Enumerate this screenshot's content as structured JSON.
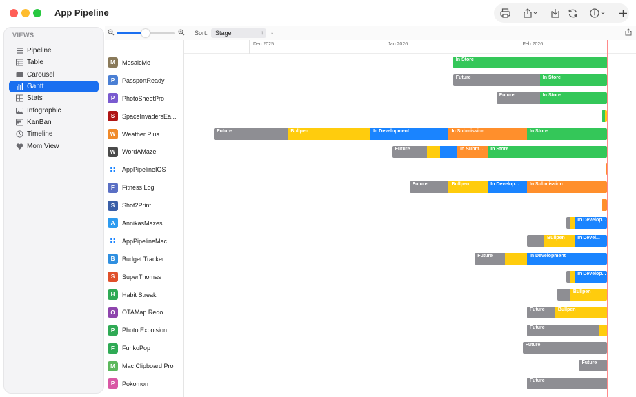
{
  "window": {
    "title": "App Pipeline"
  },
  "toolbar_icons": [
    "printer-icon",
    "share-icon",
    "download-icon",
    "sync-icon",
    "info-icon",
    "plus-icon"
  ],
  "sidebar": {
    "header": "VIEWS",
    "items": [
      {
        "label": "Pipeline",
        "icon": "list-icon"
      },
      {
        "label": "Table",
        "icon": "table-icon"
      },
      {
        "label": "Carousel",
        "icon": "carousel-icon"
      },
      {
        "label": "Gantt",
        "icon": "gantt-chart-icon",
        "active": true
      },
      {
        "label": "Stats",
        "icon": "stats-icon"
      },
      {
        "label": "Infographic",
        "icon": "image-icon"
      },
      {
        "label": "KanBan",
        "icon": "kanban-icon"
      },
      {
        "label": "Timeline",
        "icon": "clock-icon"
      },
      {
        "label": "Mom View",
        "icon": "heart-icon"
      }
    ]
  },
  "controls": {
    "zoom_level": 0.5,
    "sort_label": "Sort:",
    "sort_value": "Stage"
  },
  "date_axis": [
    {
      "label": "Dec 2025",
      "day": 0
    },
    {
      "label": "Jan 2026",
      "day": 31
    },
    {
      "label": "Feb 2026",
      "day": 62
    }
  ],
  "today_day": 81.4,
  "colors": {
    "Future": "#8e8e93",
    "Bullpen": "#ffcc0d",
    "In Development": "#1a84ff",
    "In Submission": "#ff8f2c",
    "In Store": "#34c759"
  },
  "apps": [
    {
      "name": "MosaicMe",
      "icon": "M",
      "icon_color": "#8a7a5a",
      "segments": [
        {
          "stage": "In Store",
          "label": "In Store",
          "start": 46,
          "end": 81.4
        }
      ]
    },
    {
      "name": "PassportReady",
      "icon": "P",
      "icon_color": "#4a7fd4",
      "segments": [
        {
          "stage": "Future",
          "label": "Future",
          "start": 46,
          "end": 66
        },
        {
          "stage": "In Store",
          "label": "In Store",
          "start": 66,
          "end": 81.4
        }
      ]
    },
    {
      "name": "PhotoSheetPro",
      "icon": "P",
      "icon_color": "#7a5bd0",
      "segments": [
        {
          "stage": "Future",
          "label": "Future",
          "start": 56,
          "end": 66
        },
        {
          "stage": "In Store",
          "label": "In Store",
          "start": 66,
          "end": 81.4
        }
      ]
    },
    {
      "name": "SpaceInvadersEa...",
      "icon": "S",
      "icon_color": "#b01515",
      "segments": [
        {
          "stage": "In Store",
          "label": "",
          "start": 80.2,
          "end": 81
        },
        {
          "stage": "Bullpen",
          "label": "",
          "start": 81,
          "end": 81.4
        }
      ]
    },
    {
      "name": "Weather Plus",
      "icon": "W",
      "icon_color": "#f08a2a",
      "segments": [
        {
          "stage": "Future",
          "label": "Future",
          "start": -9,
          "end": 8
        },
        {
          "stage": "Bullpen",
          "label": "Bullpen",
          "start": 8,
          "end": 27
        },
        {
          "stage": "In Development",
          "label": "In Development",
          "start": 27,
          "end": 45
        },
        {
          "stage": "In Submission",
          "label": "In Submission",
          "start": 45,
          "end": 63
        },
        {
          "stage": "In Store",
          "label": "In Store",
          "start": 63,
          "end": 81.4
        }
      ]
    },
    {
      "name": "WordAMaze",
      "icon": "W",
      "icon_color": "#4a4a4a",
      "segments": [
        {
          "stage": "Future",
          "label": "Future",
          "start": 32,
          "end": 40
        },
        {
          "stage": "Bullpen",
          "label": "",
          "start": 40,
          "end": 43
        },
        {
          "stage": "In Development",
          "label": "",
          "start": 43,
          "end": 47
        },
        {
          "stage": "In Submission",
          "label": "In Subm...",
          "start": 47,
          "end": 54
        },
        {
          "stage": "In Store",
          "label": "In Store",
          "start": 54,
          "end": 81.4
        }
      ]
    },
    {
      "name": "AppPipelineIOS",
      "icon": "∷",
      "icon_color": "#ffffff",
      "segments": [
        {
          "stage": "In Submission",
          "label": "",
          "start": 81.1,
          "end": 81.4
        }
      ]
    },
    {
      "name": "Fitness Log",
      "icon": "F",
      "icon_color": "#5a6fc4",
      "segments": [
        {
          "stage": "Future",
          "label": "Future",
          "start": 36,
          "end": 45
        },
        {
          "stage": "Bullpen",
          "label": "Bullpen",
          "start": 45,
          "end": 54
        },
        {
          "stage": "In Development",
          "label": "In Develop...",
          "start": 54,
          "end": 63
        },
        {
          "stage": "In Submission",
          "label": "In Submission",
          "start": 63,
          "end": 81.4
        }
      ]
    },
    {
      "name": "Shot2Print",
      "icon": "S",
      "icon_color": "#3a5fa8",
      "segments": [
        {
          "stage": "In Submission",
          "label": "",
          "start": 80.2,
          "end": 81.4
        }
      ]
    },
    {
      "name": "AnnikasMazes",
      "icon": "A",
      "icon_color": "#2d9bf0",
      "segments": [
        {
          "stage": "Future",
          "label": "",
          "start": 72,
          "end": 73
        },
        {
          "stage": "Bullpen",
          "label": "",
          "start": 73,
          "end": 74
        },
        {
          "stage": "In Development",
          "label": "In Develop...",
          "start": 74,
          "end": 81.4
        }
      ]
    },
    {
      "name": "AppPipelineMac",
      "icon": "∷",
      "icon_color": "#ffffff",
      "segments": [
        {
          "stage": "Future",
          "label": "",
          "start": 63,
          "end": 67
        },
        {
          "stage": "Bullpen",
          "label": "Bullpen",
          "start": 67,
          "end": 74
        },
        {
          "stage": "In Development",
          "label": "In Devel...",
          "start": 74,
          "end": 81.4
        }
      ]
    },
    {
      "name": "Budget Tracker",
      "icon": "B",
      "icon_color": "#2f8fe0",
      "segments": [
        {
          "stage": "Future",
          "label": "Future",
          "start": 51,
          "end": 58
        },
        {
          "stage": "Bullpen",
          "label": "",
          "start": 58,
          "end": 63
        },
        {
          "stage": "In Development",
          "label": "In Development",
          "start": 63,
          "end": 81.4
        }
      ]
    },
    {
      "name": "SuperThomas",
      "icon": "S",
      "icon_color": "#e0502a",
      "segments": [
        {
          "stage": "Future",
          "label": "",
          "start": 72,
          "end": 73
        },
        {
          "stage": "Bullpen",
          "label": "",
          "start": 73,
          "end": 74
        },
        {
          "stage": "In Development",
          "label": "In Develop...",
          "start": 74,
          "end": 81.4
        }
      ]
    },
    {
      "name": "Habit Streak",
      "icon": "H",
      "icon_color": "#2faa55",
      "segments": [
        {
          "stage": "Future",
          "label": "",
          "start": 70,
          "end": 73
        },
        {
          "stage": "Bullpen",
          "label": "Bullpen",
          "start": 73,
          "end": 81.4
        }
      ]
    },
    {
      "name": "OTAMap Redo",
      "icon": "O",
      "icon_color": "#8e44ad",
      "segments": [
        {
          "stage": "Future",
          "label": "Future",
          "start": 63,
          "end": 69.5
        },
        {
          "stage": "Bullpen",
          "label": "Bullpen",
          "start": 69.5,
          "end": 81.4
        }
      ]
    },
    {
      "name": "Photo Expolsion",
      "icon": "P",
      "icon_color": "#2faa55",
      "segments": [
        {
          "stage": "Future",
          "label": "Future",
          "start": 63,
          "end": 79.5
        },
        {
          "stage": "Bullpen",
          "label": "",
          "start": 79.5,
          "end": 81.4
        }
      ]
    },
    {
      "name": "FunkoPop",
      "icon": "F",
      "icon_color": "#2faa55",
      "segments": [
        {
          "stage": "Future",
          "label": "Future",
          "start": 62,
          "end": 81.4
        }
      ]
    },
    {
      "name": "Mac Clipboard Pro",
      "icon": "M",
      "icon_color": "#5cb85c",
      "segments": [
        {
          "stage": "Future",
          "label": "Future",
          "start": 75,
          "end": 81.4
        }
      ]
    },
    {
      "name": "Pokomon",
      "icon": "P",
      "icon_color": "#d957a5",
      "segments": [
        {
          "stage": "Future",
          "label": "Future",
          "start": 63,
          "end": 81.4
        }
      ]
    }
  ]
}
